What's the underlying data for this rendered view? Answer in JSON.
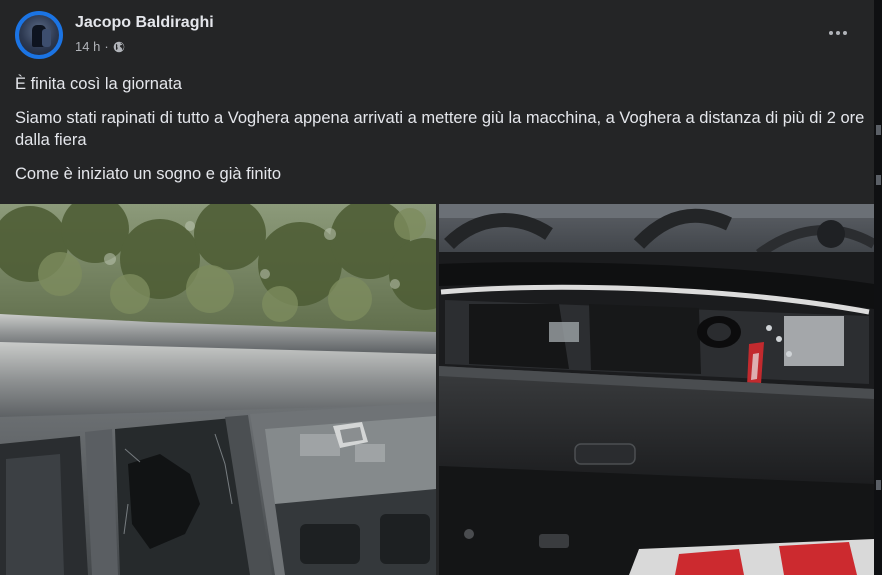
{
  "post": {
    "author": "Jacopo Baldiraghi",
    "time": "14 h",
    "separator": "·",
    "privacy_icon": "globe-icon",
    "more_icon": "more-dots-icon",
    "paragraphs": [
      "È finita così la giornata",
      "Siamo stati rapinati di tutto a Voghera appena arrivati a mettere giù la macchina, a Voghera a distanza di più di 2 ore dalla fiera",
      "Come è iniziato un sogno e già finito"
    ],
    "photos": [
      {
        "name": "photo-broken-car-window"
      },
      {
        "name": "photo-car-trunk-interior"
      }
    ]
  },
  "colors": {
    "background": "#242526",
    "text_primary": "#e4e6eb",
    "text_secondary": "#b0b3b8",
    "avatar_ring": "#1b74e4"
  }
}
